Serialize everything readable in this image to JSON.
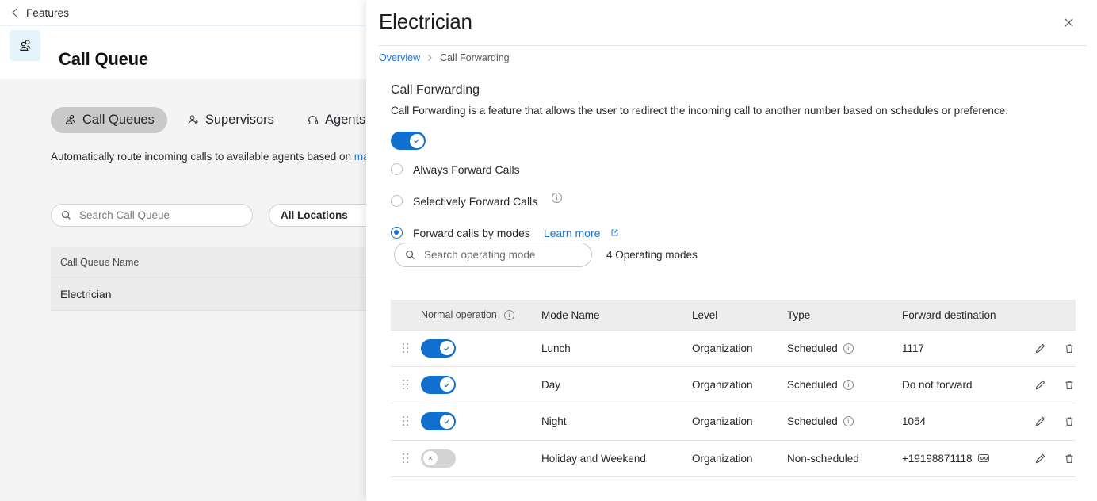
{
  "topbar": {
    "back_label": "Features",
    "back_icon": "chevron-left-icon"
  },
  "header": {
    "title": "Call Queue",
    "icon": "call-queue-group-icon"
  },
  "tabs": [
    {
      "label": "Call Queues",
      "icon": "call-queue-group-icon",
      "active": true
    },
    {
      "label": "Supervisors",
      "icon": "supervisor-person-icon",
      "active": false
    },
    {
      "label": "Agents",
      "icon": "agent-headset-icon",
      "active": false
    }
  ],
  "description": {
    "text": "Automatically route incoming calls to available agents based on",
    "link_text": "management",
    "link_icon": "external-link-icon"
  },
  "filters": {
    "search_placeholder": "Search Call Queue",
    "search_value": "",
    "search_icon": "search-icon",
    "location_value": "All Locations"
  },
  "queue_table": {
    "columns": [
      "Call Queue Name"
    ],
    "rows": [
      [
        "Electrician"
      ]
    ]
  },
  "panel": {
    "title": "Electrician",
    "close_icon": "close-icon",
    "breadcrumb": {
      "root": "Overview",
      "separator": "›",
      "current": "Call Forwarding"
    },
    "section": {
      "title": "Call Forwarding",
      "description": "Call Forwarding is a feature that allows the user to redirect the incoming call to another number based on schedules or preference.",
      "master_toggle": {
        "state": "on",
        "icon": "check-icon"
      }
    },
    "radio_options": [
      {
        "label": "Always Forward Calls",
        "selected": false,
        "info": false
      },
      {
        "label": "Selectively Forward Calls",
        "selected": false,
        "info": true,
        "info_icon": "info-icon"
      },
      {
        "label": "Forward calls by modes",
        "selected": true,
        "info": false,
        "learn_more": "Learn more",
        "learn_more_icon": "external-link-icon"
      }
    ],
    "mode_search": {
      "placeholder": "Search operating mode",
      "value": "",
      "icon": "search-icon",
      "count_label": "4 Operating modes"
    },
    "modes_table": {
      "columns": {
        "normal_operation": "Normal operation",
        "normal_operation_info_icon": "info-icon",
        "mode_name": "Mode Name",
        "level": "Level",
        "type": "Type",
        "forward_destination": "Forward destination"
      },
      "rows": [
        {
          "toggle": "on",
          "mode_name": "Lunch",
          "level": "Organization",
          "type": "Scheduled",
          "type_info": true,
          "destination": "1117",
          "dest_icon": "",
          "edit_icon": "pencil-icon",
          "delete_icon": "trash-icon",
          "drag_icon": "drag-handle-icon"
        },
        {
          "toggle": "on",
          "mode_name": "Day",
          "level": "Organization",
          "type": "Scheduled",
          "type_info": true,
          "destination": "Do not forward",
          "dest_icon": "",
          "edit_icon": "pencil-icon",
          "delete_icon": "trash-icon",
          "drag_icon": "drag-handle-icon"
        },
        {
          "toggle": "on",
          "mode_name": "Night",
          "level": "Organization",
          "type": "Scheduled",
          "type_info": true,
          "destination": "1054",
          "dest_icon": "",
          "edit_icon": "pencil-icon",
          "delete_icon": "trash-icon",
          "drag_icon": "drag-handle-icon"
        },
        {
          "toggle": "off",
          "mode_name": "Holiday and Weekend",
          "level": "Organization",
          "type": "Non-scheduled",
          "type_info": false,
          "destination": "+19198871118",
          "dest_icon": "voicemail-icon",
          "edit_icon": "pencil-icon",
          "delete_icon": "trash-icon",
          "drag_icon": "drag-handle-icon"
        }
      ]
    }
  },
  "colors": {
    "accent_blue": "#1170cf",
    "link_blue": "#2176d2",
    "toggle_off": "#d3d3d3",
    "header_chip": "#e5f3fb",
    "table_header_bg": "#ededed"
  }
}
